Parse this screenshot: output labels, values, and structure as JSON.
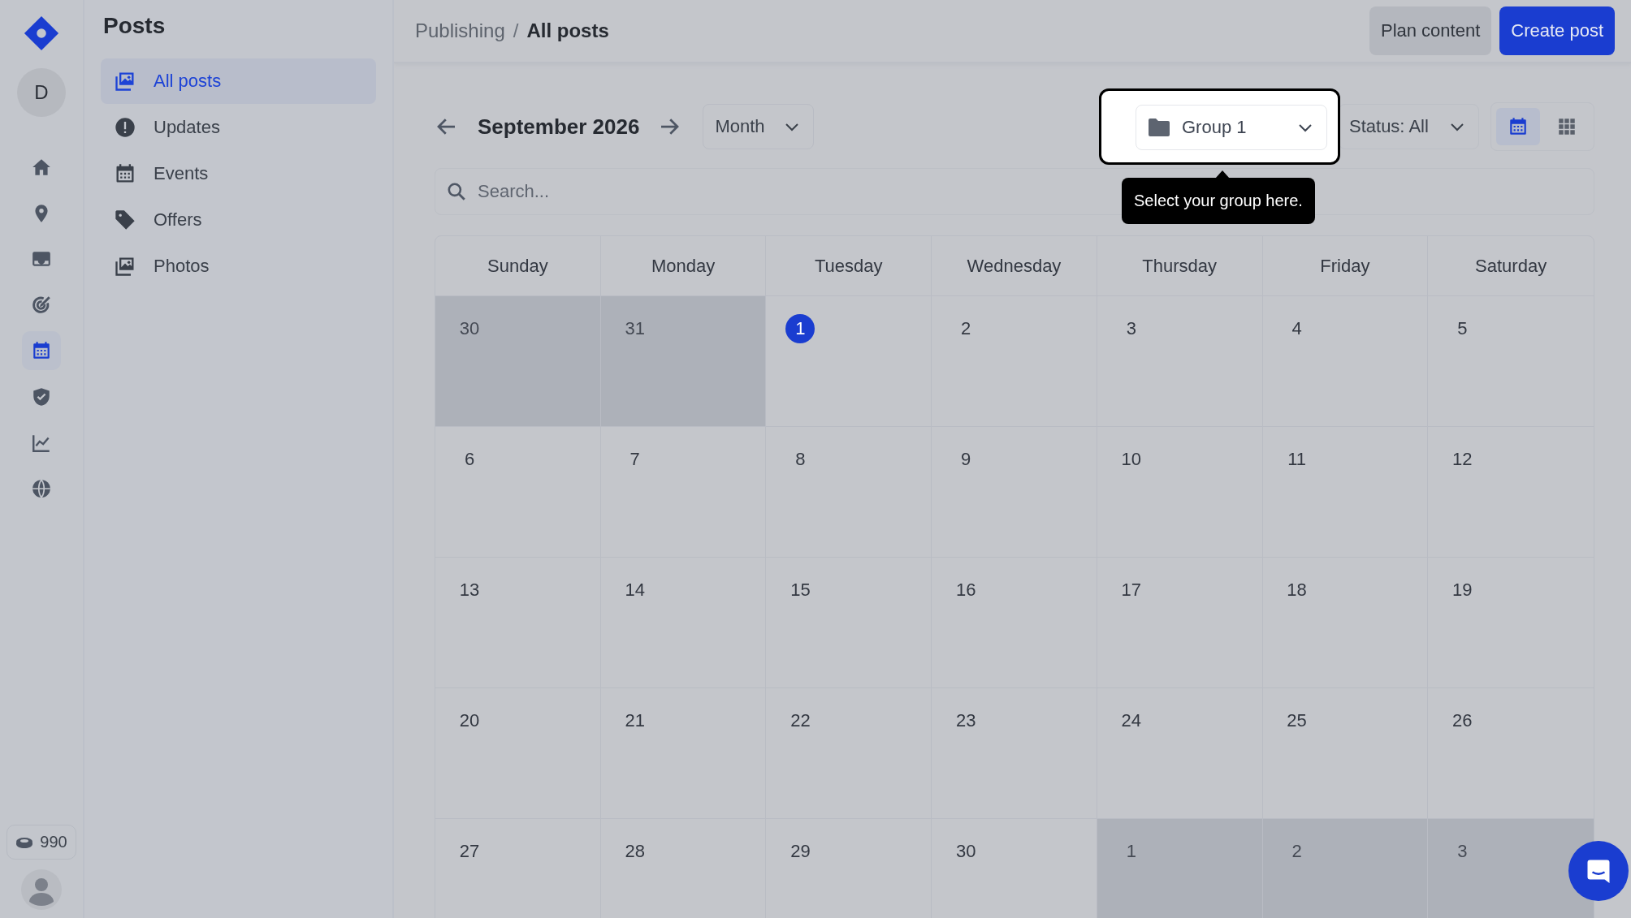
{
  "rail": {
    "avatar_letter": "D",
    "items": [
      {
        "selected": false
      },
      {
        "selected": false
      },
      {
        "selected": false
      },
      {
        "selected": false
      },
      {
        "selected": true
      },
      {
        "selected": false
      },
      {
        "selected": false
      },
      {
        "selected": false
      }
    ],
    "credits": "990"
  },
  "sidebar": {
    "title": "Posts",
    "items": [
      {
        "label": "All posts",
        "selected": true
      },
      {
        "label": "Updates",
        "selected": false
      },
      {
        "label": "Events",
        "selected": false
      },
      {
        "label": "Offers",
        "selected": false
      },
      {
        "label": "Photos",
        "selected": false
      }
    ]
  },
  "header": {
    "breadcrumbs": [
      "Publishing",
      "All posts"
    ],
    "separator": "/",
    "buttons": [
      {
        "label": "Plan content",
        "kind": "secondary"
      },
      {
        "label": "Create post",
        "kind": "primary"
      }
    ]
  },
  "toolbar": {
    "month": "September 2026",
    "view_select": "Month",
    "group_select": "Group 1",
    "status_select": "Status: All",
    "view_toggle": [
      {
        "selected": true
      },
      {
        "selected": false
      }
    ]
  },
  "tooltip": "Select your group here.",
  "search": {
    "placeholder": "Search..."
  },
  "calendar": {
    "weekdays": [
      "Sunday",
      "Monday",
      "Tuesday",
      "Wednesday",
      "Thursday",
      "Friday",
      "Saturday"
    ],
    "days": [
      {
        "label": "30",
        "outside": true,
        "today": false
      },
      {
        "label": "31",
        "outside": true,
        "today": false
      },
      {
        "label": "1",
        "outside": false,
        "today": true
      },
      {
        "label": "2",
        "outside": false,
        "today": false
      },
      {
        "label": "3",
        "outside": false,
        "today": false
      },
      {
        "label": "4",
        "outside": false,
        "today": false
      },
      {
        "label": "5",
        "outside": false,
        "today": false
      },
      {
        "label": "6",
        "outside": false,
        "today": false
      },
      {
        "label": "7",
        "outside": false,
        "today": false
      },
      {
        "label": "8",
        "outside": false,
        "today": false
      },
      {
        "label": "9",
        "outside": false,
        "today": false
      },
      {
        "label": "10",
        "outside": false,
        "today": false
      },
      {
        "label": "11",
        "outside": false,
        "today": false
      },
      {
        "label": "12",
        "outside": false,
        "today": false
      },
      {
        "label": "13",
        "outside": false,
        "today": false
      },
      {
        "label": "14",
        "outside": false,
        "today": false
      },
      {
        "label": "15",
        "outside": false,
        "today": false
      },
      {
        "label": "16",
        "outside": false,
        "today": false
      },
      {
        "label": "17",
        "outside": false,
        "today": false
      },
      {
        "label": "18",
        "outside": false,
        "today": false
      },
      {
        "label": "19",
        "outside": false,
        "today": false
      },
      {
        "label": "20",
        "outside": false,
        "today": false
      },
      {
        "label": "21",
        "outside": false,
        "today": false
      },
      {
        "label": "22",
        "outside": false,
        "today": false
      },
      {
        "label": "23",
        "outside": false,
        "today": false
      },
      {
        "label": "24",
        "outside": false,
        "today": false
      },
      {
        "label": "25",
        "outside": false,
        "today": false
      },
      {
        "label": "26",
        "outside": false,
        "today": false
      },
      {
        "label": "27",
        "outside": false,
        "today": false
      },
      {
        "label": "28",
        "outside": false,
        "today": false
      },
      {
        "label": "29",
        "outside": false,
        "today": false
      },
      {
        "label": "30",
        "outside": false,
        "today": false
      },
      {
        "label": "1",
        "outside": true,
        "today": false
      },
      {
        "label": "2",
        "outside": true,
        "today": false
      },
      {
        "label": "3",
        "outside": true,
        "today": false
      }
    ]
  }
}
